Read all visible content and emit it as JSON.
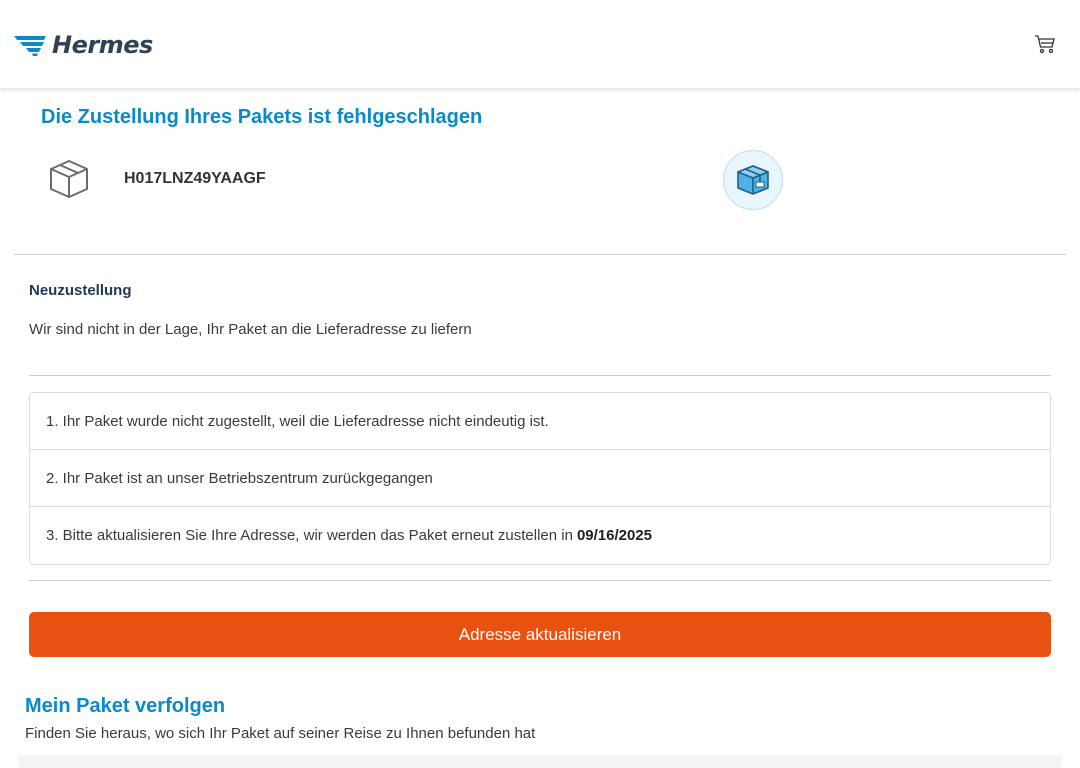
{
  "header": {
    "brand": "Hermes",
    "cart_icon": "shopping-cart-icon"
  },
  "shipment": {
    "title": "Die Zustellung Ihres Pakets ist fehlgeschlagen",
    "tracking_number": "H017LNZ49YAAGF",
    "package_icon": "package-outline-icon",
    "status_icon": "parcel-badge-icon"
  },
  "redelivery": {
    "heading": "Neuzustellung",
    "description": "Wir sind nicht in der Lage, Ihr Paket an die Lieferadresse zu liefern",
    "steps": [
      {
        "text": "1. Ihr Paket wurde nicht zugestellt, weil die Lieferadresse nicht eindeutig ist."
      },
      {
        "text": "2. Ihr Paket ist an unser Betriebszentrum zurückgegangen"
      },
      {
        "text": "3. Bitte aktualisieren Sie Ihre Adresse, wir werden das Paket erneut zustellen in",
        "date": "09/16/2025"
      }
    ],
    "button_label": "Adresse aktualisieren"
  },
  "tracking_section": {
    "title": "Mein Paket verfolgen",
    "subtitle": "Finden Sie heraus, wo sich Ihr Paket auf seiner Reise zu Ihnen befunden hat"
  },
  "colors": {
    "brand_blue": "#0a8ac8",
    "cta_orange": "#e8510f",
    "navy": "#223a57"
  }
}
